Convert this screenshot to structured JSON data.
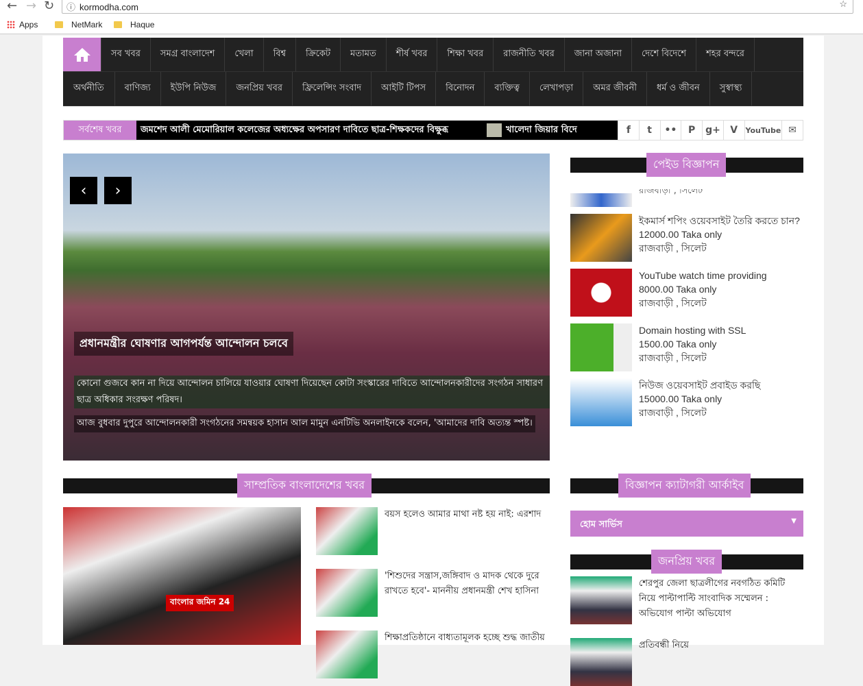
{
  "browser": {
    "url": "kormodha.com",
    "bookmarks": [
      "Apps",
      "NetMark",
      "Haque"
    ]
  },
  "nav": {
    "row1": [
      "সব খবর",
      "সমগ্র বাংলাদেশ",
      "খেলা",
      "বিশ্ব",
      "ক্রিকেট",
      "মতামত",
      "শীর্ষ খবর",
      "শিক্ষা খবর",
      "রাজনীতি খবর",
      "জানা অজানা",
      "দেশে বিদেশে",
      "শহর বন্দরে"
    ],
    "row2": [
      "অর্থনীতি",
      "বাণিজ্য",
      "ইউপি নিউজ",
      "জনপ্রিয় খবর",
      "ফ্রিলেন্সিং সংবাদ",
      "আইটি টিপস",
      "বিনোদন",
      "ব্যক্তিত্ব",
      "লেখাপড়া",
      "অমর জীবনী",
      "ধর্ম ও জীবন",
      "সুস্বাস্থ্য"
    ]
  },
  "ticker": {
    "label": "সর্বশেষ খবর",
    "items": [
      "জমশেদ আলী মেমোরিয়াল কলেজের অধ্যক্ষের অপসারণ দাবিতে ছাত্র-শিক্ষকদের বিক্ষুব্ধ",
      "খালেদা জিয়ার বিদে"
    ]
  },
  "social": [
    "f",
    "t",
    "••",
    "P",
    "g+",
    "V",
    "YouTube",
    "✉"
  ],
  "slider": {
    "title": "প্রধানমন্ত্রীর ঘোষণার আগপর্যন্ত আন্দোলন চলবে",
    "desc": "কোনো গুজবে কান না দিয়ে আন্দোলন চালিয়ে যাওয়ার ঘোষণা দিয়েছেন কোটা সংস্কারের দাবিতে আন্দোলনকারীদের সংগঠন সাধারণ ছাত্র অধিকার সংরক্ষণ পরিষদ।",
    "desc2": "আজ বুধবার দুপুরে আন্দোলনকারী সংগঠনের সমন্বয়ক হাসান আল মামুন এনটিভি অনলাইনকে বলেন, 'আমাদের দাবি অত্যন্ত স্পষ্ট।"
  },
  "paid_ads": {
    "title": "পেইড বিজ্ঞাপন",
    "partial_location": "রাজবাড়ী , সিলেট",
    "items": [
      {
        "title": "ইকমার্স শপিং ওয়েবসাইট তৈরি করতে চান?",
        "price": "12000.00 Taka only",
        "location": "রাজবাড়ী , সিলেট"
      },
      {
        "title": "YouTube watch time providing",
        "price": "8000.00 Taka only",
        "location": "রাজবাড়ী , সিলেট"
      },
      {
        "title": "Domain hosting with SSL",
        "price": "1500.00 Taka only",
        "location": "রাজবাড়ী , সিলেট"
      },
      {
        "title": "নিউজ ওয়েবসাইট প্রবাইড করছি",
        "price": "15000.00 Taka only",
        "location": "রাজবাড়ী , সিলেট"
      }
    ]
  },
  "recent": {
    "title": "সাম্প্রতিক বাংলাদেশের খবর",
    "big_image_text": "বাংলার জমিন 24",
    "items": [
      "বয়স হলেও আমার মাথা নষ্ট হয় নাই: এরশাদ",
      "'শিশুদের সন্ত্রাস,জঙ্গিবাদ ও মাদক থেকে দুরে রাখতে হবে'- মাননীয় প্রধানমন্ত্রী শেখ হাসিনা",
      "শিক্ষাপ্রতিষ্ঠানে বাধ্যতামূলক হচ্ছে শুদ্ধ জাতীয়"
    ]
  },
  "archive": {
    "title": "বিজ্ঞাপন ক্যাটাগরী আর্কাইব",
    "selected": "হোম সার্ভিস"
  },
  "popular": {
    "title": "জনপ্রিয় খবর",
    "items": [
      "শেরপুর জেলা ছাত্রলীগের নবগঠিত কমিটি নিয়ে পাল্টাপাল্টি সাংবাদিক সম্মেলন : অভিযোগ পাল্টা অভিযোগ",
      "প্রতিবন্ধী নিয়ে"
    ]
  }
}
